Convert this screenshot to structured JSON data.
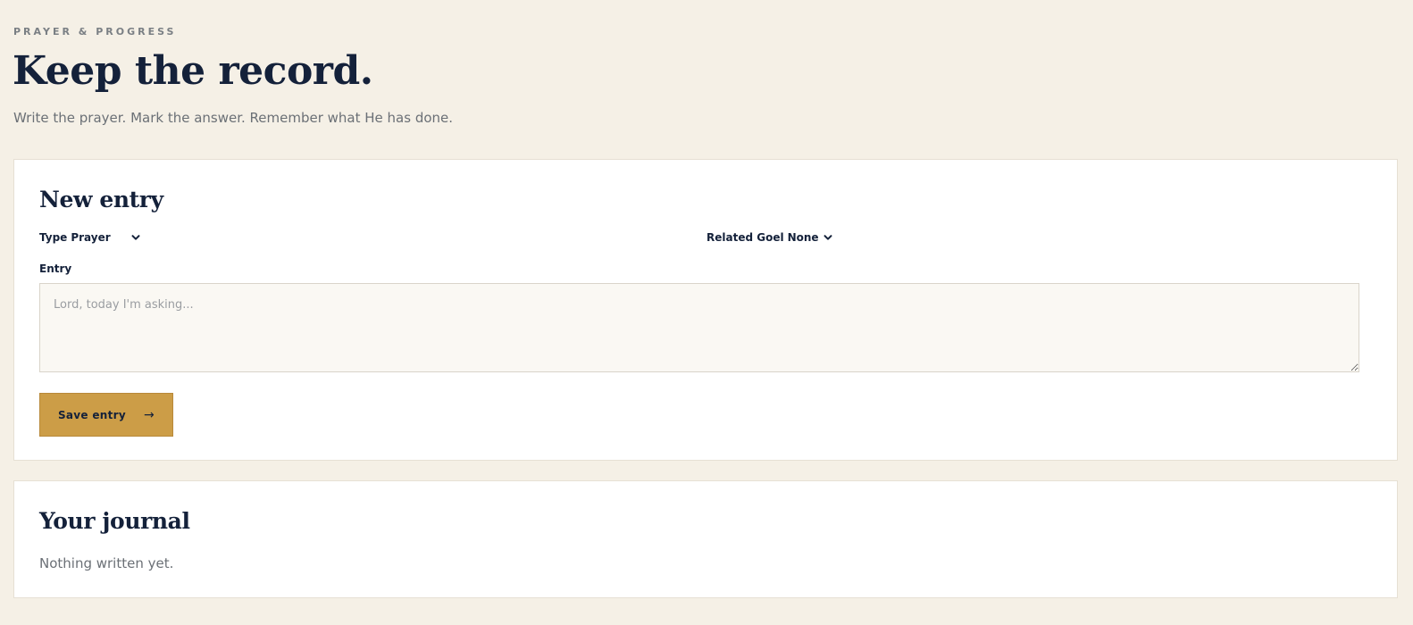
{
  "header": {
    "eyebrow": "PRAYER & PROGRESS",
    "title": "Keep the record.",
    "subtitle": "Write the prayer. Mark the answer. Remember what He has done."
  },
  "new_entry": {
    "title": "New entry",
    "type_label": "Type",
    "type_value": "Prayer",
    "goal_label": "Related Goel",
    "goal_value": "None",
    "entry_label": "Entry",
    "entry_placeholder": "Lord, today I'm asking...",
    "entry_value": "",
    "save_label": "Save entry",
    "save_arrow": "→"
  },
  "journal": {
    "title": "Your journal",
    "empty_text": "Nothing written yet."
  },
  "colors": {
    "background": "#f5f0e6",
    "ink": "#14213a",
    "accent": "#cc9d47",
    "muted": "#6b7076"
  }
}
